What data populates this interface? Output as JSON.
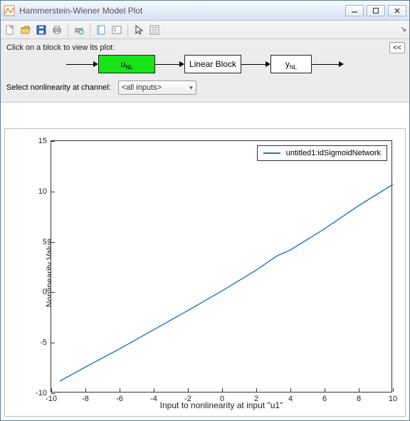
{
  "window": {
    "title": "Hammerstein-Wiener Model Plot",
    "buttons": {
      "min": "–",
      "max": "▢",
      "close": "✕"
    }
  },
  "toolbar": {
    "icons": [
      "new-file",
      "open-file",
      "save",
      "print",
      "print-preview",
      "tile",
      "legend-toggle",
      "pointer",
      "properties"
    ]
  },
  "top_panel": {
    "hint": "Click on a block to view its plot:",
    "collapse": "<<",
    "blocks": {
      "u_label_main": "u",
      "u_label_sub": "NL",
      "linear_label": "Linear Block",
      "y_label_main": "y",
      "y_label_sub": "NL",
      "selected": "u"
    },
    "select_label": "Select nonlinearity at channel:",
    "select_value": "<all inputs>"
  },
  "chart_data": {
    "type": "line",
    "xlabel": "Input to nonlinearity at input \"u1\"",
    "ylabel": "Nonlinearity Value",
    "xlim": [
      -10,
      10
    ],
    "ylim": [
      -10,
      15
    ],
    "xticks": [
      -10,
      -8,
      -6,
      -4,
      -2,
      0,
      2,
      4,
      6,
      8,
      10
    ],
    "yticks": [
      -10,
      -5,
      0,
      5,
      10,
      15
    ],
    "series": [
      {
        "name": "untitled1:idSigmoidNetwork",
        "color": "#1f77b4",
        "x": [
          -9.5,
          -8,
          -6,
          -4,
          -2,
          0,
          2,
          3.2,
          4,
          6,
          8,
          10
        ],
        "y": [
          -8.8,
          -7.4,
          -5.6,
          -3.7,
          -1.8,
          0.15,
          2.2,
          3.6,
          4.2,
          6.3,
          8.6,
          10.7
        ]
      }
    ]
  }
}
